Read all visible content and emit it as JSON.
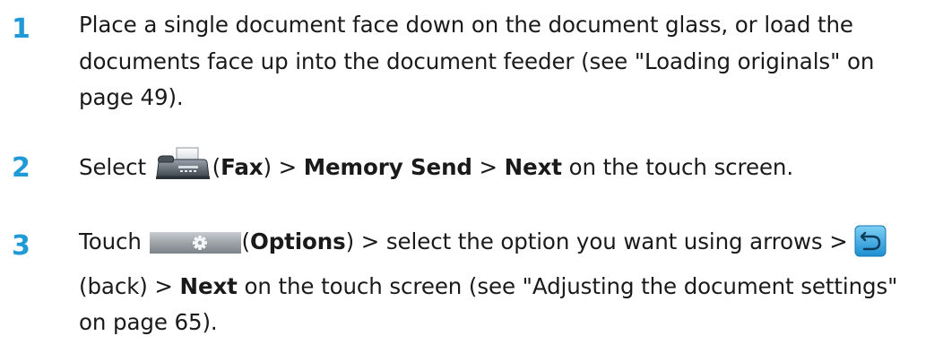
{
  "steps": [
    {
      "number": "1",
      "text": "Place a single document face down on the document glass, or load the documents face up into the document feeder (see \"Loading originals\" on page 49)."
    },
    {
      "number": "2",
      "prefix": "Select ",
      "fax_label": "Fax",
      "sep1": " > ",
      "memory_send": "Memory Send",
      "sep2": " > ",
      "next": "Next",
      "suffix": " on the touch screen."
    },
    {
      "number": "3",
      "touch": "Touch ",
      "options_label": "Options",
      "after_options": " > select the option you want using arrows > ",
      "back_label": "(back) > ",
      "next": "Next",
      "suffix": " on the touch screen (see \"Adjusting the document settings\" on page 65)."
    }
  ],
  "icons": {
    "fax": "fax-machine-icon",
    "options": "gear-options-button-icon",
    "back": "back-arrow-icon"
  },
  "colors": {
    "step_number": "#1f9ad6",
    "body_text": "#1a1a1a"
  }
}
